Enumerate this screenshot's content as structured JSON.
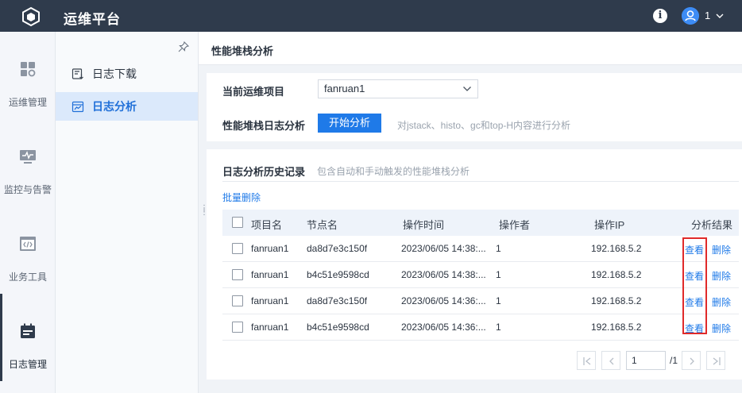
{
  "app": {
    "title": "运维平台",
    "user_count": "1"
  },
  "rail": {
    "items": [
      {
        "label": "运维管理"
      },
      {
        "label": "监控与告警"
      },
      {
        "label": "业务工具"
      },
      {
        "label": "日志管理"
      }
    ]
  },
  "subnav": {
    "items": [
      {
        "label": "日志下载"
      },
      {
        "label": "日志分析"
      }
    ]
  },
  "page": {
    "title": "性能堆栈分析"
  },
  "project": {
    "label": "当前运维项目",
    "selected": "fanruan1",
    "analysis_label": "性能堆栈日志分析",
    "start_button": "开始分析",
    "start_hint": "对jstack、histo、gc和top-H内容进行分析"
  },
  "history": {
    "title": "日志分析历史记录",
    "subtitle": "包含自动和手动触发的性能堆栈分析",
    "batch_delete": "批量删除",
    "columns": [
      "项目名",
      "节点名",
      "操作时间",
      "操作者",
      "操作IP",
      "分析结果"
    ],
    "rows": [
      {
        "project": "fanruan1",
        "node": "da8d7e3c150f",
        "time": "2023/06/05 14:38:...",
        "operator": "1",
        "ip": "192.168.5.2",
        "view": "查看",
        "delete": "删除"
      },
      {
        "project": "fanruan1",
        "node": "b4c51e9598cd",
        "time": "2023/06/05 14:38:...",
        "operator": "1",
        "ip": "192.168.5.2",
        "view": "查看",
        "delete": "删除"
      },
      {
        "project": "fanruan1",
        "node": "da8d7e3c150f",
        "time": "2023/06/05 14:36:...",
        "operator": "1",
        "ip": "192.168.5.2",
        "view": "查看",
        "delete": "删除"
      },
      {
        "project": "fanruan1",
        "node": "b4c51e9598cd",
        "time": "2023/06/05 14:36:...",
        "operator": "1",
        "ip": "192.168.5.2",
        "view": "查看",
        "delete": "删除"
      }
    ]
  },
  "pagination": {
    "current": "1",
    "total": "/1"
  },
  "colors": {
    "topbar": "#2f3b4c",
    "accent": "#1f7ae8",
    "highlight": "#e02a2a"
  },
  "icons": {
    "logo": "cube-logo-icon",
    "info": "info-icon",
    "user": "user-avatar-icon",
    "rail": [
      "dashboard-grid-icon",
      "monitor-icon",
      "code-window-icon",
      "calendar-log-icon"
    ],
    "subnav": [
      "download-list-icon",
      "chart-calendar-icon"
    ]
  }
}
